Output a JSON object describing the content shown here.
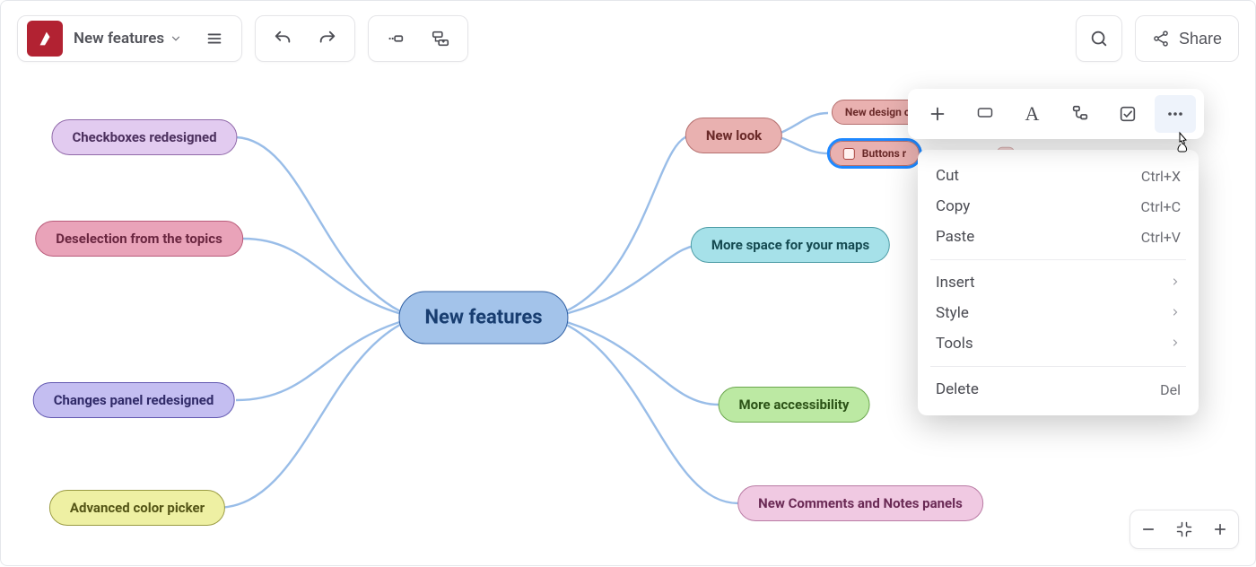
{
  "doc": {
    "title": "New features"
  },
  "toolbar": {
    "share_label": "Share"
  },
  "mindmap": {
    "center": "New features",
    "left": [
      "Checkboxes redesigned",
      "Deselection from the topics",
      "Changes panel redesigned",
      "Advanced color picker"
    ],
    "right": [
      "New look",
      "More space for your maps",
      "More accessibility",
      "New Comments and Notes panels"
    ],
    "newlook_children": [
      "New design c",
      "Buttons r"
    ]
  },
  "contextmenu": {
    "cut": {
      "label": "Cut",
      "shortcut": "Ctrl+X"
    },
    "copy": {
      "label": "Copy",
      "shortcut": "Ctrl+C"
    },
    "paste": {
      "label": "Paste",
      "shortcut": "Ctrl+V"
    },
    "insert": {
      "label": "Insert"
    },
    "style": {
      "label": "Style"
    },
    "tools": {
      "label": "Tools"
    },
    "delete": {
      "label": "Delete",
      "shortcut": "Del"
    }
  }
}
